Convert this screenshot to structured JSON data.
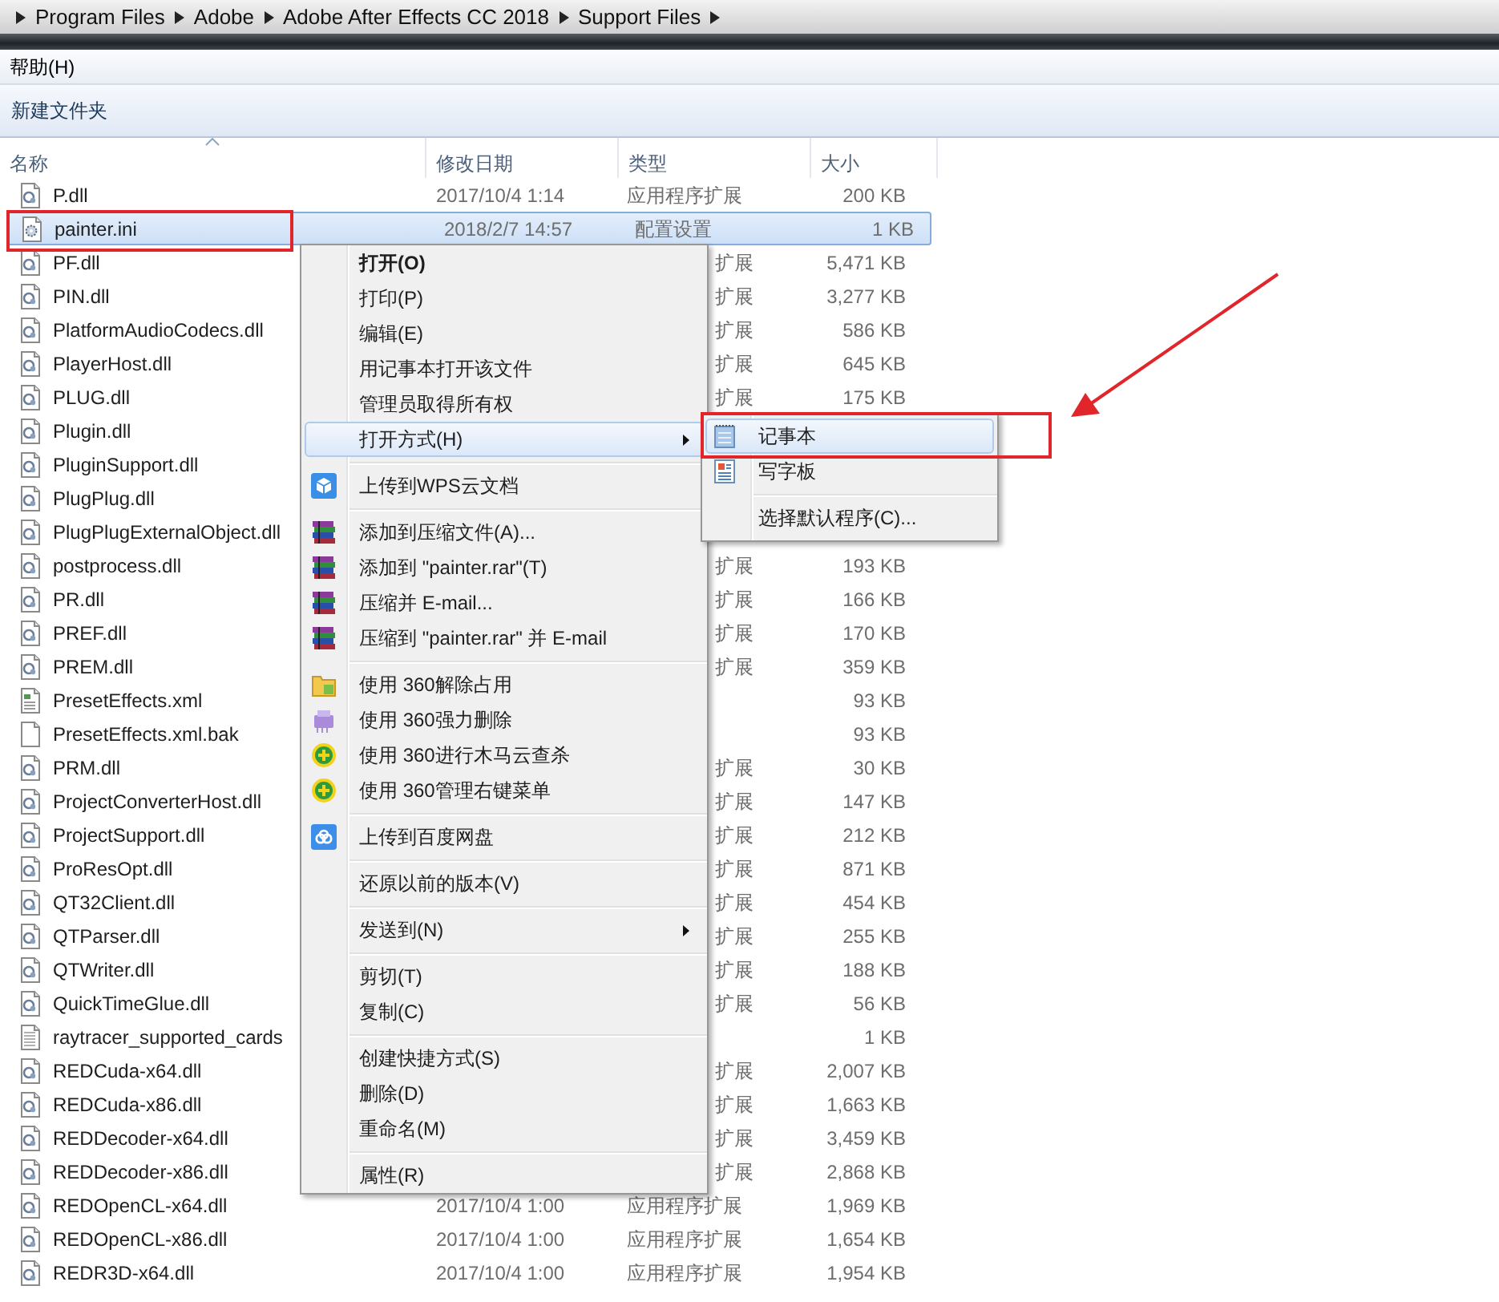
{
  "breadcrumb": [
    "Program Files",
    "Adobe",
    "Adobe After Effects CC 2018",
    "Support Files"
  ],
  "menu_bar": [
    "帮助(H)"
  ],
  "toolbar": [
    "新建文件夹"
  ],
  "columns": [
    {
      "label": "名称",
      "sorted": true
    },
    {
      "label": "修改日期",
      "sorted": false
    },
    {
      "label": "类型",
      "sorted": false
    },
    {
      "label": "大小",
      "sorted": false
    }
  ],
  "rows": [
    {
      "name": "P.dll",
      "kind": "dll",
      "date": "2017/10/4 1:14",
      "type": "应用程序扩展",
      "size": "200 KB",
      "selected": false
    },
    {
      "name": "painter.ini",
      "kind": "ini",
      "date": "2018/2/7 14:57",
      "type": "配置设置",
      "size": "1 KB",
      "selected": true
    },
    {
      "name": "PF.dll",
      "kind": "dll",
      "type": "扩展",
      "size": "5,471 KB",
      "selected": false
    },
    {
      "name": "PIN.dll",
      "kind": "dll",
      "type": "扩展",
      "size": "3,277 KB",
      "selected": false
    },
    {
      "name": "PlatformAudioCodecs.dll",
      "kind": "dll",
      "type": "扩展",
      "size": "586 KB",
      "selected": false
    },
    {
      "name": "PlayerHost.dll",
      "kind": "dll",
      "type": "扩展",
      "size": "645 KB",
      "selected": false
    },
    {
      "name": "PLUG.dll",
      "kind": "dll",
      "type": "扩展",
      "size": "175 KB",
      "selected": false
    },
    {
      "name": "Plugin.dll",
      "kind": "dll",
      "selected": false
    },
    {
      "name": "PluginSupport.dll",
      "kind": "dll",
      "selected": false
    },
    {
      "name": "PlugPlug.dll",
      "kind": "dll",
      "selected": false
    },
    {
      "name": "PlugPlugExternalObject.dll",
      "kind": "dll",
      "selected": false
    },
    {
      "name": "postprocess.dll",
      "kind": "dll",
      "type": "扩展",
      "size": "193 KB",
      "selected": false
    },
    {
      "name": "PR.dll",
      "kind": "dll",
      "type": "扩展",
      "size": "166 KB",
      "selected": false
    },
    {
      "name": "PREF.dll",
      "kind": "dll",
      "type": "扩展",
      "size": "170 KB",
      "selected": false
    },
    {
      "name": "PREM.dll",
      "kind": "dll",
      "type": "扩展",
      "size": "359 KB",
      "selected": false
    },
    {
      "name": "PresetEffects.xml",
      "kind": "xml",
      "size": "93 KB",
      "selected": false
    },
    {
      "name": "PresetEffects.xml.bak",
      "kind": "blank",
      "size": "93 KB",
      "selected": false
    },
    {
      "name": "PRM.dll",
      "kind": "dll",
      "type": "扩展",
      "size": "30 KB",
      "selected": false
    },
    {
      "name": "ProjectConverterHost.dll",
      "kind": "dll",
      "type": "扩展",
      "size": "147 KB",
      "selected": false
    },
    {
      "name": "ProjectSupport.dll",
      "kind": "dll",
      "type": "扩展",
      "size": "212 KB",
      "selected": false
    },
    {
      "name": "ProResOpt.dll",
      "kind": "dll",
      "type": "扩展",
      "size": "871 KB",
      "selected": false
    },
    {
      "name": "QT32Client.dll",
      "kind": "dll",
      "type": "扩展",
      "size": "454 KB",
      "selected": false
    },
    {
      "name": "QTParser.dll",
      "kind": "dll",
      "type": "扩展",
      "size": "255 KB",
      "selected": false
    },
    {
      "name": "QTWriter.dll",
      "kind": "dll",
      "type": "扩展",
      "size": "188 KB",
      "selected": false
    },
    {
      "name": "QuickTimeGlue.dll",
      "kind": "dll",
      "type": "扩展",
      "size": "56 KB",
      "selected": false
    },
    {
      "name": "raytracer_supported_cards",
      "kind": "text",
      "size": "1 KB",
      "selected": false
    },
    {
      "name": "REDCuda-x64.dll",
      "kind": "dll",
      "type": "扩展",
      "size": "2,007 KB",
      "selected": false
    },
    {
      "name": "REDCuda-x86.dll",
      "kind": "dll",
      "type": "扩展",
      "size": "1,663 KB",
      "selected": false
    },
    {
      "name": "REDDecoder-x64.dll",
      "kind": "dll",
      "type": "扩展",
      "size": "3,459 KB",
      "selected": false
    },
    {
      "name": "REDDecoder-x86.dll",
      "kind": "dll",
      "type": "扩展",
      "size": "2,868 KB",
      "selected": false
    },
    {
      "name": "REDOpenCL-x64.dll",
      "kind": "dll",
      "date": "2017/10/4 1:00",
      "type": "应用程序扩展",
      "size": "1,969 KB",
      "selected": false
    },
    {
      "name": "REDOpenCL-x86.dll",
      "kind": "dll",
      "date": "2017/10/4 1:00",
      "type": "应用程序扩展",
      "size": "1,654 KB",
      "selected": false
    },
    {
      "name": "REDR3D-x64.dll",
      "kind": "dll",
      "date": "2017/10/4 1:00",
      "type": "应用程序扩展",
      "size": "1,954 KB",
      "selected": false
    }
  ],
  "context_menu": [
    {
      "kind": "plain",
      "label": "打开(O)",
      "default": true,
      "selected": false,
      "submenu": false
    },
    {
      "kind": "plain",
      "label": "打印(P)",
      "default": false,
      "selected": false,
      "submenu": false
    },
    {
      "kind": "plain",
      "label": "编辑(E)",
      "default": false,
      "selected": false,
      "submenu": false
    },
    {
      "kind": "plain",
      "label": "用记事本打开该文件",
      "default": false,
      "selected": false,
      "submenu": false
    },
    {
      "kind": "plain",
      "label": "管理员取得所有权",
      "default": false,
      "selected": false,
      "submenu": false
    },
    {
      "kind": "plain",
      "label": "打开方式(H)",
      "default": false,
      "selected": true,
      "submenu": true
    },
    {
      "kind": "separator"
    },
    {
      "kind": "wps",
      "label": "上传到WPS云文档",
      "default": false,
      "selected": false,
      "submenu": false
    },
    {
      "kind": "separator"
    },
    {
      "kind": "archive",
      "label": "添加到压缩文件(A)...",
      "default": false,
      "selected": false,
      "submenu": false
    },
    {
      "kind": "archive",
      "label": "添加到 \"painter.rar\"(T)",
      "default": false,
      "selected": false,
      "submenu": false
    },
    {
      "kind": "archive",
      "label": "压缩并 E-mail...",
      "default": false,
      "selected": false,
      "submenu": false
    },
    {
      "kind": "archive",
      "label": "压缩到 \"painter.rar\" 并 E-mail",
      "default": false,
      "selected": false,
      "submenu": false
    },
    {
      "kind": "separator"
    },
    {
      "kind": "folder",
      "label": "使用 360解除占用",
      "default": false,
      "selected": false,
      "submenu": false
    },
    {
      "kind": "shredder",
      "label": "使用 360强力删除",
      "default": false,
      "selected": false,
      "submenu": false
    },
    {
      "kind": "plus",
      "label": "使用 360进行木马云查杀",
      "default": false,
      "selected": false,
      "submenu": false
    },
    {
      "kind": "plus",
      "label": "使用 360管理右键菜单",
      "default": false,
      "selected": false,
      "submenu": false
    },
    {
      "kind": "separator"
    },
    {
      "kind": "cloud",
      "label": "上传到百度网盘",
      "default": false,
      "selected": false,
      "submenu": false
    },
    {
      "kind": "separator"
    },
    {
      "kind": "plain",
      "label": "还原以前的版本(V)",
      "default": false,
      "selected": false,
      "submenu": false
    },
    {
      "kind": "separator"
    },
    {
      "kind": "plain",
      "label": "发送到(N)",
      "default": false,
      "selected": false,
      "submenu": true
    },
    {
      "kind": "separator"
    },
    {
      "kind": "plain",
      "label": "剪切(T)",
      "default": false,
      "selected": false,
      "submenu": false
    },
    {
      "kind": "plain",
      "label": "复制(C)",
      "default": false,
      "selected": false,
      "submenu": false
    },
    {
      "kind": "separator"
    },
    {
      "kind": "plain",
      "label": "创建快捷方式(S)",
      "default": false,
      "selected": false,
      "submenu": false
    },
    {
      "kind": "plain",
      "label": "删除(D)",
      "default": false,
      "selected": false,
      "submenu": false
    },
    {
      "kind": "plain",
      "label": "重命名(M)",
      "default": false,
      "selected": false,
      "submenu": false
    },
    {
      "kind": "separator"
    },
    {
      "kind": "plain",
      "label": "属性(R)",
      "default": false,
      "selected": false,
      "submenu": false
    }
  ],
  "open_with_menu": [
    {
      "kind": "notepad",
      "label": "记事本",
      "selected": true
    },
    {
      "kind": "wordpad",
      "label": "写字板",
      "selected": false
    },
    {
      "kind": "separator"
    },
    {
      "kind": "plain",
      "label": "选择默认程序(C)...",
      "selected": false
    }
  ]
}
